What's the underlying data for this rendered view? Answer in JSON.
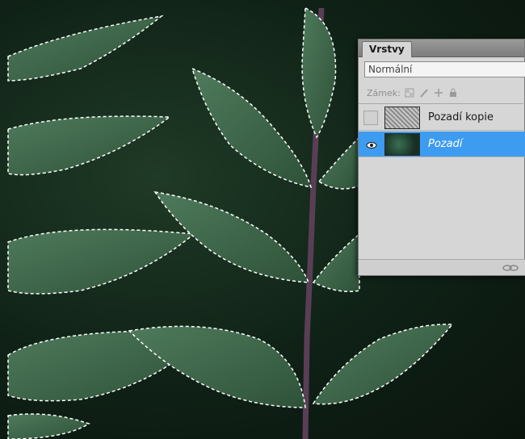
{
  "canvas": {
    "description_icon": "leaf-image",
    "selection_style": "marching-ants"
  },
  "layers_panel": {
    "tab_label": "Vrstvy",
    "blend_mode": "Normální",
    "lock_label": "Zámek:",
    "lock_icons": [
      "lock-transparent-icon",
      "lock-paint-icon",
      "lock-move-icon",
      "lock-all-icon"
    ],
    "layers": [
      {
        "name": "Pozadí kopie",
        "visible": false,
        "active": false
      },
      {
        "name": "Pozadí",
        "visible": true,
        "active": true
      }
    ],
    "footer_icons": [
      "link-layers-icon"
    ]
  },
  "colors": {
    "selection_highlight": "#3e9cf0",
    "panel_bg": "#d6d6d6"
  }
}
